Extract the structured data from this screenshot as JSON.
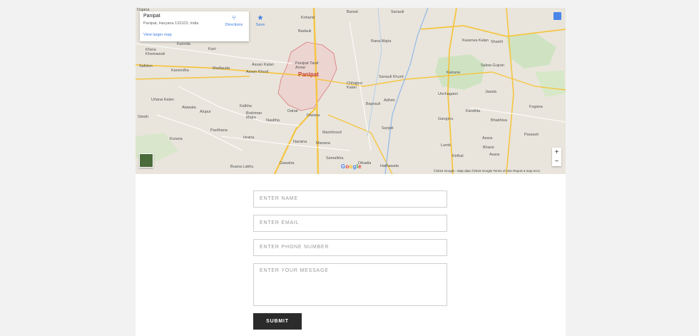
{
  "map": {
    "info": {
      "title": "Panipat",
      "address": "Panipat, Haryana 132103, India",
      "larger_map_link": "View larger map",
      "directions_label": "Directions",
      "save_label": "Save"
    },
    "labels": {
      "city": "Panipat",
      "dujana": "Dujana",
      "kohand": "Kohand",
      "barsat": "Barsat",
      "sanauli": "Sanauli",
      "khera_khemawati": "Khera Khemawati",
      "karinda": "Karinda",
      "kavi": "Kavi",
      "badauli": "Badauli",
      "safidon": "Safidon",
      "karsindha": "Karsindha",
      "madlauda": "Madlauda",
      "assan_kalan": "Assan Kalan",
      "assan_khurd": "Assan Khurd",
      "panipat_taraf_ansar": "Panipat Taraf Ansar",
      "rana_majra": "Rana Majra",
      "kaserwa_kalan": "Kaserwa Kalan",
      "shamli": "Shamli",
      "kairana": "Kairana",
      "salwa_gujran": "Salwa Gujran",
      "unchagaon": "Unchagaon",
      "jasala": "Jasala",
      "sanauli_khurd": "Sanauli Khurd",
      "chhajpur_kalan": "Chhajpur Kalan",
      "adhmi": "Adhmi",
      "baprauli": "Baprauli",
      "urlana_kalan": "Urlana Kalan",
      "atawala": "Atawala",
      "alupur": "Alupur",
      "kalkha": "Kalkha",
      "brahman_majra": "Brahman Majra",
      "naultha": "Naultha",
      "dahar": "Dahar",
      "diwana": "Diwana",
      "siwah": "Siwah",
      "pardhana": "Pardhana",
      "machhrouli": "Machhrouli",
      "sanjoli": "Sanjoli",
      "kandhla": "Kandhla",
      "bhabhisa": "Bhabhisa",
      "fugana": "Fugana",
      "gangeru": "Gangeru",
      "israna": "Israna",
      "kurana": "Kurana",
      "naraina": "Naraina",
      "manana": "Manana",
      "lumb": "Lumb",
      "bharsi": "Bharsi",
      "asara": "Asara",
      "parasoli": "Parasoli",
      "kirthal": "Kirthal",
      "samalkha": "Samalkha",
      "gawalra": "Gawalra",
      "dikadla": "Dikadla",
      "hathawala": "Hathawala",
      "buana_lakhu": "Buana Lakhu"
    },
    "attribution": "©2016 Google - Map data ©2016 Google    Terms of Use    Report a map error",
    "zoom_in": "+",
    "zoom_out": "−"
  },
  "form": {
    "name_placeholder": "ENTER NAME",
    "email_placeholder": "ENTER EMAIL",
    "phone_placeholder": "ENTER PHONE NUMBER",
    "message_placeholder": "ENTER YOUR MESSAGE",
    "submit_label": "SUBMIT"
  }
}
